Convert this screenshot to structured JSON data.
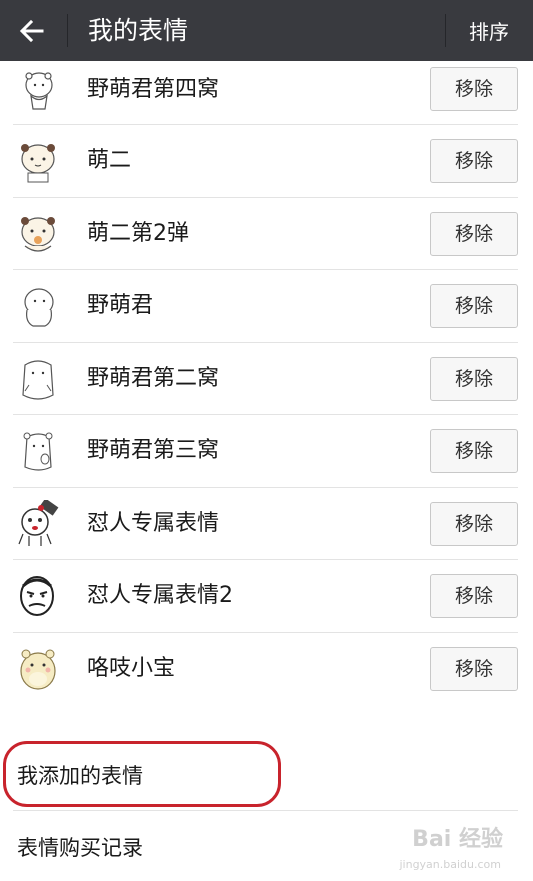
{
  "header": {
    "title": "我的表情",
    "sort_label": "排序",
    "back_icon": "arrow-left-icon",
    "background": "#393a3f"
  },
  "sticker_list": {
    "remove_label": "移除",
    "items": [
      {
        "name": "野萌君第四窝",
        "icon": "cartoon-bear-icon"
      },
      {
        "name": "萌二",
        "icon": "cartoon-panda-icon"
      },
      {
        "name": "萌二第2弹",
        "icon": "cartoon-panda-icon"
      },
      {
        "name": "野萌君",
        "icon": "cartoon-bear-icon"
      },
      {
        "name": "野萌君第二窝",
        "icon": "cartoon-bear-icon"
      },
      {
        "name": "野萌君第三窝",
        "icon": "cartoon-bear-icon"
      },
      {
        "name": "怼人专属表情",
        "icon": "meme-face-icon"
      },
      {
        "name": "怼人专属表情2",
        "icon": "meme-face-icon"
      },
      {
        "name": "咯吱小宝",
        "icon": "cartoon-hamster-icon"
      }
    ]
  },
  "footer_links": {
    "my_added": "我添加的表情",
    "purchase_history": "表情购买记录"
  },
  "watermark": {
    "text": "Bai 经验",
    "sub": "jingyan.baidu.com"
  },
  "colors": {
    "highlight": "#c8232c",
    "divider": "#e3e3e3"
  }
}
